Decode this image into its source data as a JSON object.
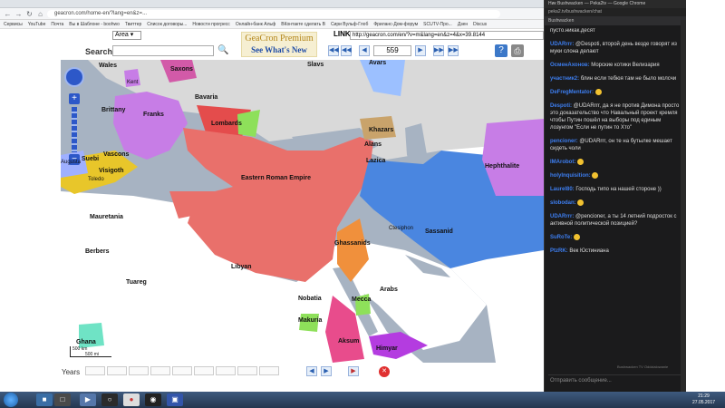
{
  "browser": {
    "url": "geacron.com/home-en/?lang=en&z=...",
    "bookmarks": [
      "Сервисы",
      "YouTube",
      "Почта",
      "Вы в Шаблоне - boohwo",
      "Твиттер",
      "Список договоры...",
      "Новости прогресс",
      "Онлайн-банк Альф",
      "ВКонтакте сделать В",
      "Сири Вульф-Глоб",
      "Фриланс-Дом-форум",
      "SCUTV-Про...",
      "Дзен",
      "Discus"
    ]
  },
  "page": {
    "area_value": "Area",
    "search_label": "Search",
    "logo_title": "GeaCron Premium",
    "logo_sub": "See What's New",
    "link_label": "LINK",
    "link_value": "http://geacron.com/en/?v=m&lang=en&z=4&x=39.8144",
    "year_value": "559",
    "help_label": "?",
    "years_label": "Years"
  },
  "map": {
    "labels": [
      {
        "text": "Wales"
      },
      {
        "text": "Saxons"
      },
      {
        "text": "Slavs"
      },
      {
        "text": "Avars"
      },
      {
        "text": "Kent"
      },
      {
        "text": "Bavaria"
      },
      {
        "text": "Brittany"
      },
      {
        "text": "Franks"
      },
      {
        "text": "Lombards"
      },
      {
        "text": "Khazars"
      },
      {
        "text": "Alans"
      },
      {
        "text": "Vascons"
      },
      {
        "text": "Suebi"
      },
      {
        "text": "Augusta"
      },
      {
        "text": "Visigoth"
      },
      {
        "text": "Toledo"
      },
      {
        "text": "Lazica"
      },
      {
        "text": "Hephthalite"
      },
      {
        "text": "Eastern Roman Empire"
      },
      {
        "text": "Mauretania"
      },
      {
        "text": "Ctesiphon"
      },
      {
        "text": "Sassanid"
      },
      {
        "text": "Ghassanids"
      },
      {
        "text": "Berbers"
      },
      {
        "text": "Libyan"
      },
      {
        "text": "Tuareg"
      },
      {
        "text": "Arabs"
      },
      {
        "text": "Nobatia"
      },
      {
        "text": "Mecca"
      },
      {
        "text": "Makuria"
      },
      {
        "text": "Ghana"
      },
      {
        "text": "Aksum"
      },
      {
        "text": "Himyar"
      }
    ],
    "scale_km": "500 km",
    "scale_mi": "500 mi"
  },
  "chat": {
    "title": "Ник Bushwacken — Peka2tv — Google Chrome",
    "url": "peka2.tv/bushwacken/chat",
    "header": "Bushwacken",
    "messages": [
      {
        "nick": "",
        "text": "пусто.никак.десят"
      },
      {
        "nick": "UDARrrr:",
        "text": "@Despoti, второй день везде говорят из муки слона делают"
      },
      {
        "nick": "ОсменАхонов:",
        "text": "Морские котики Велизария"
      },
      {
        "nick": "участник2:",
        "text": "блин если тебюя там не было молсчи"
      },
      {
        "nick": "DeFregMentator:",
        "text": ""
      },
      {
        "nick": "Despoti:",
        "text": "@UDARrrr, да я не против Димона просто это доказательство что Навальный проект кремля чтобы Путин пошёл на выборы под единым лозунгом \"Если не путин то Хто\""
      },
      {
        "nick": "pencioner:",
        "text": "@UDARrrr, он те на бутылке мешает сидеть чоли"
      },
      {
        "nick": "IMArobot:",
        "text": ""
      },
      {
        "nick": "holyInquisition:",
        "text": ""
      },
      {
        "nick": "Laurel80:",
        "text": "Господь типо на нашей стороне ))"
      },
      {
        "nick": "slobodan:",
        "text": ""
      },
      {
        "nick": "UDARrrr:",
        "text": "@pencioner, а ты 14 летний подросток с активной политической позицией?"
      },
      {
        "nick": "SuRoTe:",
        "text": ""
      },
      {
        "nick": "PtzRK:",
        "text": "Век Юстиниана"
      }
    ],
    "footer_meta": "Bushwacken TV   Oddzialowanie",
    "input_placeholder": "Отправить сообщение..."
  },
  "taskbar": {
    "time": "21:29",
    "date": "27.05.2017"
  }
}
